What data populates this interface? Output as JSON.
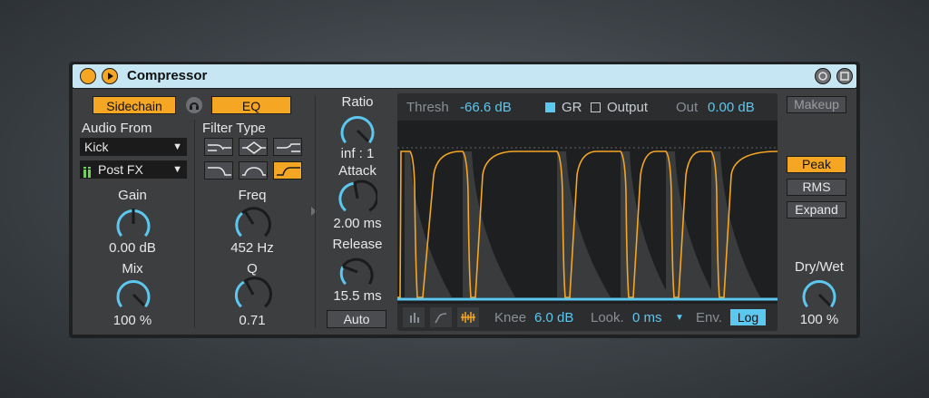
{
  "device": {
    "title": "Compressor"
  },
  "sidechain": {
    "sidechain_label": "Sidechain",
    "eq_label": "EQ",
    "audio_from_label": "Audio From",
    "audio_from_value": "Kick",
    "tap_value": "Post FX",
    "filter_type_label": "Filter Type",
    "gain_label": "Gain",
    "gain_value": "0.00 dB",
    "mix_label": "Mix",
    "mix_value": "100 %",
    "freq_label": "Freq",
    "freq_value": "452 Hz",
    "q_label": "Q",
    "q_value": "0.71"
  },
  "dynamics": {
    "ratio_label": "Ratio",
    "ratio_value": "inf : 1",
    "attack_label": "Attack",
    "attack_value": "2.00 ms",
    "release_label": "Release",
    "release_value": "15.5 ms",
    "auto_label": "Auto"
  },
  "display": {
    "thresh_label": "Thresh",
    "thresh_value": "-66.6 dB",
    "gr_label": "GR",
    "output_label": "Output",
    "out_label": "Out",
    "out_value": "0.00 dB",
    "knee_label": "Knee",
    "knee_value": "6.0 dB",
    "look_label": "Look.",
    "look_value": "0 ms",
    "env_label": "Env.",
    "env_value": "Log"
  },
  "right": {
    "makeup_label": "Makeup",
    "peak_label": "Peak",
    "rms_label": "RMS",
    "expand_label": "Expand",
    "drywet_label": "Dry/Wet",
    "drywet_value": "100 %"
  },
  "colors": {
    "accent": "#f5a623",
    "value_blue": "#5cc7ef",
    "title_bar": "#c5e6f2",
    "panel": "#3d3e40"
  }
}
